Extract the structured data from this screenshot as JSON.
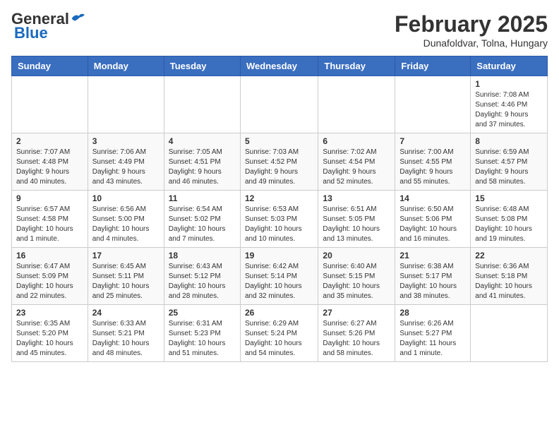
{
  "header": {
    "logo_general": "General",
    "logo_blue": "Blue",
    "month": "February 2025",
    "location": "Dunafoldvar, Tolna, Hungary"
  },
  "weekdays": [
    "Sunday",
    "Monday",
    "Tuesday",
    "Wednesday",
    "Thursday",
    "Friday",
    "Saturday"
  ],
  "weeks": [
    [
      {
        "day": "",
        "info": ""
      },
      {
        "day": "",
        "info": ""
      },
      {
        "day": "",
        "info": ""
      },
      {
        "day": "",
        "info": ""
      },
      {
        "day": "",
        "info": ""
      },
      {
        "day": "",
        "info": ""
      },
      {
        "day": "1",
        "info": "Sunrise: 7:08 AM\nSunset: 4:46 PM\nDaylight: 9 hours\nand 37 minutes."
      }
    ],
    [
      {
        "day": "2",
        "info": "Sunrise: 7:07 AM\nSunset: 4:48 PM\nDaylight: 9 hours\nand 40 minutes."
      },
      {
        "day": "3",
        "info": "Sunrise: 7:06 AM\nSunset: 4:49 PM\nDaylight: 9 hours\nand 43 minutes."
      },
      {
        "day": "4",
        "info": "Sunrise: 7:05 AM\nSunset: 4:51 PM\nDaylight: 9 hours\nand 46 minutes."
      },
      {
        "day": "5",
        "info": "Sunrise: 7:03 AM\nSunset: 4:52 PM\nDaylight: 9 hours\nand 49 minutes."
      },
      {
        "day": "6",
        "info": "Sunrise: 7:02 AM\nSunset: 4:54 PM\nDaylight: 9 hours\nand 52 minutes."
      },
      {
        "day": "7",
        "info": "Sunrise: 7:00 AM\nSunset: 4:55 PM\nDaylight: 9 hours\nand 55 minutes."
      },
      {
        "day": "8",
        "info": "Sunrise: 6:59 AM\nSunset: 4:57 PM\nDaylight: 9 hours\nand 58 minutes."
      }
    ],
    [
      {
        "day": "9",
        "info": "Sunrise: 6:57 AM\nSunset: 4:58 PM\nDaylight: 10 hours\nand 1 minute."
      },
      {
        "day": "10",
        "info": "Sunrise: 6:56 AM\nSunset: 5:00 PM\nDaylight: 10 hours\nand 4 minutes."
      },
      {
        "day": "11",
        "info": "Sunrise: 6:54 AM\nSunset: 5:02 PM\nDaylight: 10 hours\nand 7 minutes."
      },
      {
        "day": "12",
        "info": "Sunrise: 6:53 AM\nSunset: 5:03 PM\nDaylight: 10 hours\nand 10 minutes."
      },
      {
        "day": "13",
        "info": "Sunrise: 6:51 AM\nSunset: 5:05 PM\nDaylight: 10 hours\nand 13 minutes."
      },
      {
        "day": "14",
        "info": "Sunrise: 6:50 AM\nSunset: 5:06 PM\nDaylight: 10 hours\nand 16 minutes."
      },
      {
        "day": "15",
        "info": "Sunrise: 6:48 AM\nSunset: 5:08 PM\nDaylight: 10 hours\nand 19 minutes."
      }
    ],
    [
      {
        "day": "16",
        "info": "Sunrise: 6:47 AM\nSunset: 5:09 PM\nDaylight: 10 hours\nand 22 minutes."
      },
      {
        "day": "17",
        "info": "Sunrise: 6:45 AM\nSunset: 5:11 PM\nDaylight: 10 hours\nand 25 minutes."
      },
      {
        "day": "18",
        "info": "Sunrise: 6:43 AM\nSunset: 5:12 PM\nDaylight: 10 hours\nand 28 minutes."
      },
      {
        "day": "19",
        "info": "Sunrise: 6:42 AM\nSunset: 5:14 PM\nDaylight: 10 hours\nand 32 minutes."
      },
      {
        "day": "20",
        "info": "Sunrise: 6:40 AM\nSunset: 5:15 PM\nDaylight: 10 hours\nand 35 minutes."
      },
      {
        "day": "21",
        "info": "Sunrise: 6:38 AM\nSunset: 5:17 PM\nDaylight: 10 hours\nand 38 minutes."
      },
      {
        "day": "22",
        "info": "Sunrise: 6:36 AM\nSunset: 5:18 PM\nDaylight: 10 hours\nand 41 minutes."
      }
    ],
    [
      {
        "day": "23",
        "info": "Sunrise: 6:35 AM\nSunset: 5:20 PM\nDaylight: 10 hours\nand 45 minutes."
      },
      {
        "day": "24",
        "info": "Sunrise: 6:33 AM\nSunset: 5:21 PM\nDaylight: 10 hours\nand 48 minutes."
      },
      {
        "day": "25",
        "info": "Sunrise: 6:31 AM\nSunset: 5:23 PM\nDaylight: 10 hours\nand 51 minutes."
      },
      {
        "day": "26",
        "info": "Sunrise: 6:29 AM\nSunset: 5:24 PM\nDaylight: 10 hours\nand 54 minutes."
      },
      {
        "day": "27",
        "info": "Sunrise: 6:27 AM\nSunset: 5:26 PM\nDaylight: 10 hours\nand 58 minutes."
      },
      {
        "day": "28",
        "info": "Sunrise: 6:26 AM\nSunset: 5:27 PM\nDaylight: 11 hours\nand 1 minute."
      },
      {
        "day": "",
        "info": ""
      }
    ]
  ]
}
